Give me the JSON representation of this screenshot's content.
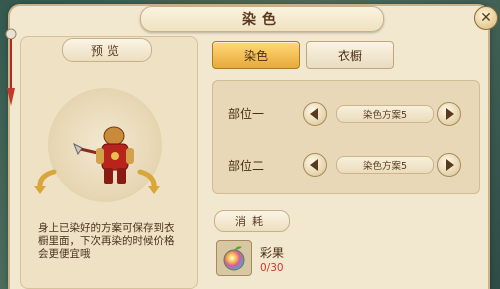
{
  "window": {
    "title": "染色"
  },
  "preview": {
    "label": "预览",
    "description": "身上已染好的方案可保存到衣橱里面，下次再染的时候价格会更便宜哦"
  },
  "tabs": [
    {
      "label": "染色",
      "active": true
    },
    {
      "label": "衣橱",
      "active": false
    }
  ],
  "parts": [
    {
      "label": "部位一",
      "scheme": "染色方案5"
    },
    {
      "label": "部位二",
      "scheme": "染色方案5"
    }
  ],
  "cost": {
    "label": "消耗",
    "item_name": "彩果",
    "item_count": "0/30"
  },
  "colors": {
    "accent": "#e8a93a",
    "panel": "#f2e7cf",
    "count_red": "#d0392b"
  },
  "icons": [
    "close-icon",
    "rotate-left-icon",
    "rotate-right-icon",
    "arrow-left-icon",
    "arrow-right-icon",
    "colorful-fruit-icon"
  ]
}
